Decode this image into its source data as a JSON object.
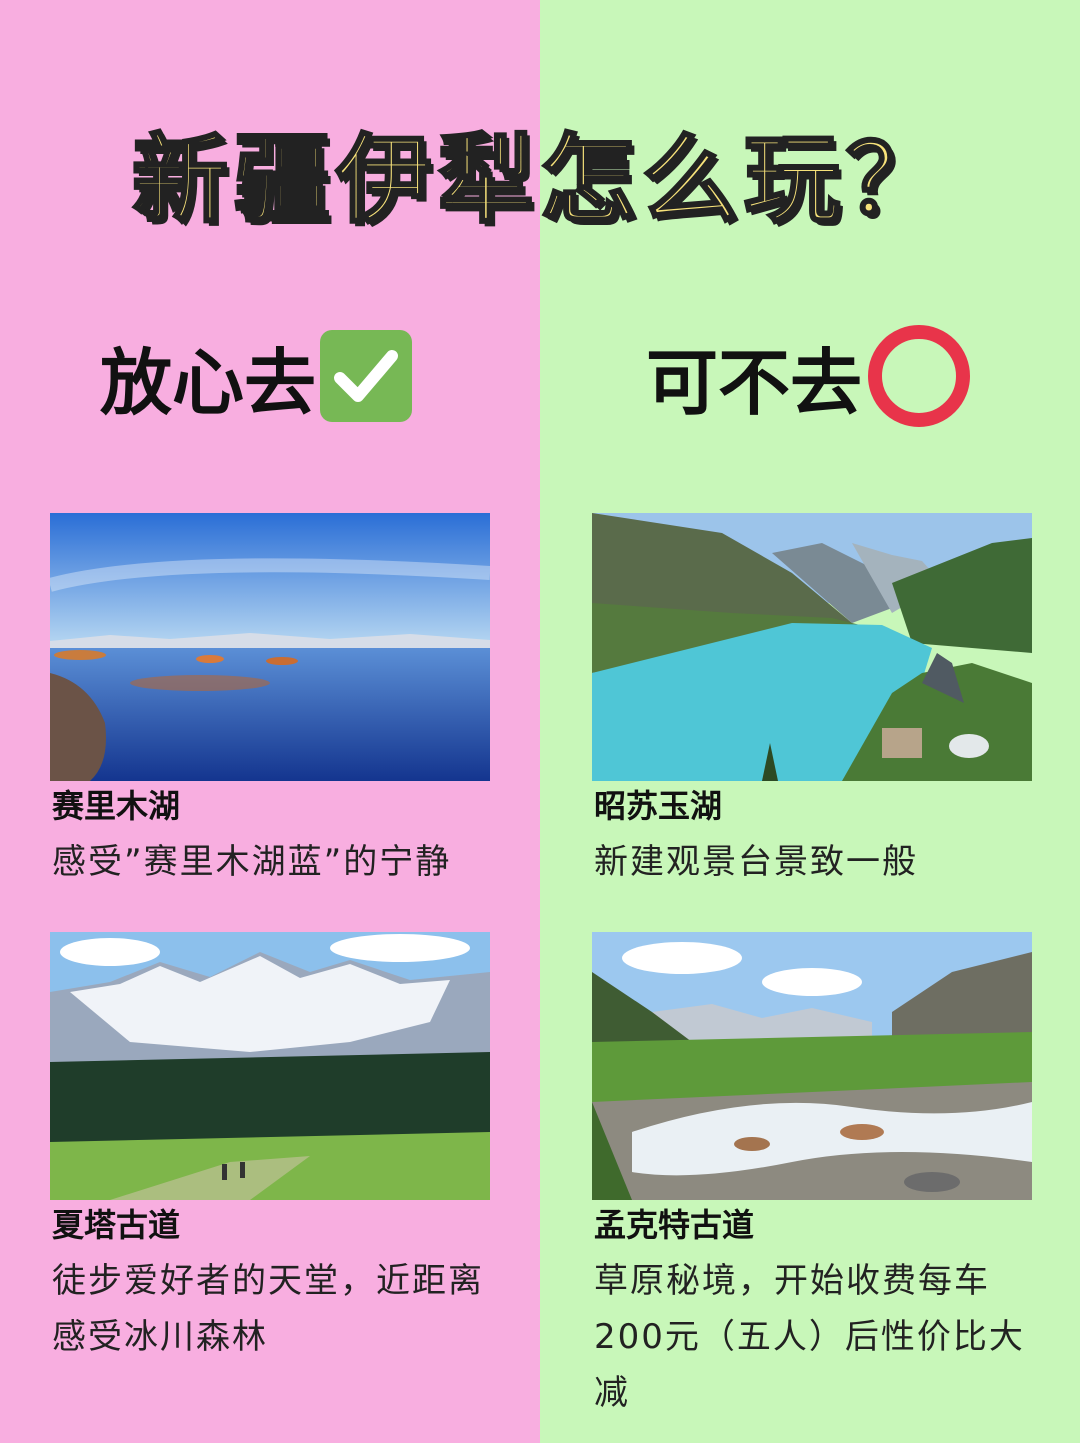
{
  "title": "新疆伊犁怎么玩？",
  "colors": {
    "left_bg": "#f8aee0",
    "right_bg": "#c8f7b9",
    "title_fill": "#f7e27a",
    "check_green": "#77b855",
    "ring_red": "#e8344a"
  },
  "left": {
    "heading": "放心去",
    "icon": "check-mark-icon",
    "items": [
      {
        "name": "赛里木湖",
        "desc": "感受”赛里木湖蓝”的宁静"
      },
      {
        "name": "夏塔古道",
        "desc_line1": "徒步爱好者的天堂，近距离",
        "desc_line2": "感受冰川森林"
      }
    ]
  },
  "right": {
    "heading": "可不去",
    "icon": "red-circle-icon",
    "items": [
      {
        "name": "昭苏玉湖",
        "desc": "新建观景台景致一般"
      },
      {
        "name": "孟克特古道",
        "desc_line1": "草原秘境，开始收费每车",
        "desc_line2": "200元（五人）后性价比大减"
      }
    ]
  }
}
